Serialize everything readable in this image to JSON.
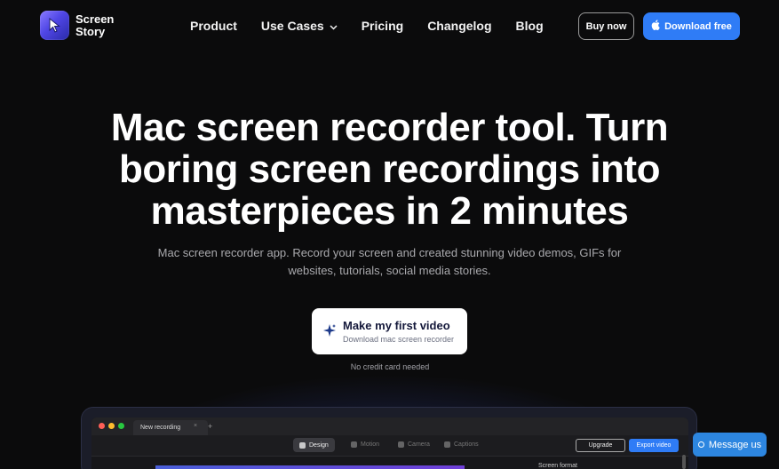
{
  "brand": {
    "name_line1": "Screen",
    "name_line2": "Story",
    "logo_icon": "cursor-arrow-icon"
  },
  "nav": {
    "links": [
      {
        "label": "Product"
      },
      {
        "label": "Use Cases",
        "has_dropdown": true
      },
      {
        "label": "Pricing"
      },
      {
        "label": "Changelog"
      },
      {
        "label": "Blog"
      }
    ],
    "buy_label": "Buy now",
    "download_label": "Download free"
  },
  "hero": {
    "title": "Mac screen recorder tool. Turn boring screen recordings into masterpieces in 2 minutes",
    "subtitle": "Mac screen recorder app. Record your screen and created stunning video demos, GIFs for websites, tutorials, social media stories.",
    "cta_main": "Make my first video",
    "cta_sub": "Download mac screen recorder",
    "note": "No credit card needed"
  },
  "app_preview": {
    "tab_label": "New recording",
    "tab_close": "×",
    "tab_add": "+",
    "toolbar_items": [
      {
        "label": "Design",
        "active": true
      },
      {
        "label": "Motion",
        "active": false
      },
      {
        "label": "Camera",
        "active": false
      },
      {
        "label": "Captions",
        "active": false
      }
    ],
    "upgrade_label": "Upgrade",
    "export_label": "Export video",
    "panel_label": "Screen format"
  },
  "chat": {
    "label": "Message us"
  },
  "colors": {
    "background": "#0b0b0c",
    "accent": "#2f7cf6",
    "chat_button": "#2d86e0",
    "traffic_red": "#ff5f57",
    "traffic_yellow": "#febc2e",
    "traffic_green": "#28c840"
  }
}
